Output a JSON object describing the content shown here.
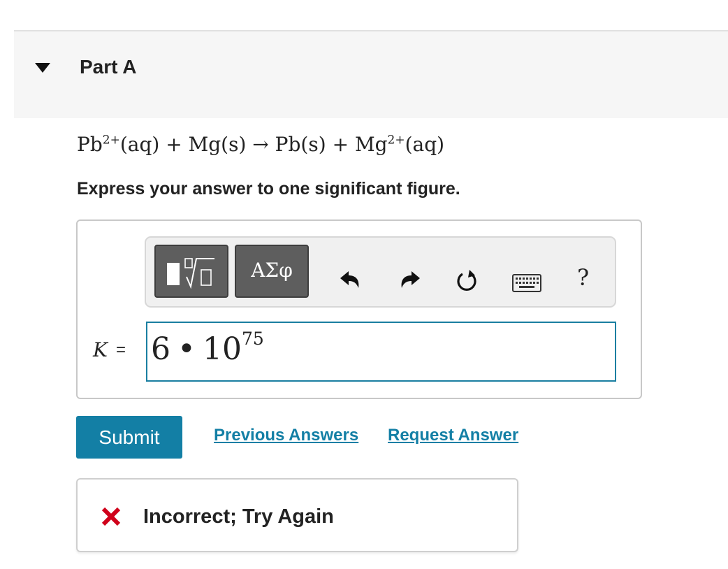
{
  "part": {
    "title": "Part A"
  },
  "equation": {
    "ion1": "Pb",
    "ion1_charge": "2+",
    "state1": "(aq)",
    "plus1": "+",
    "reactant2": "Mg(s)",
    "arrow": "→",
    "product1": "Pb(s)",
    "plus2": "+",
    "ion2": "Mg",
    "ion2_charge": "2+",
    "state2": "(aq)"
  },
  "instruction": "Express your answer to one significant figure.",
  "toolbar": {
    "templates_icon": "templates-sqrt-icon",
    "greek_label": "ΑΣφ",
    "undo_icon": "undo-icon",
    "redo_icon": "redo-icon",
    "reset_icon": "reset-icon",
    "keyboard_icon": "keyboard-icon",
    "help_label": "?"
  },
  "answer": {
    "variable": "K",
    "equals": "=",
    "coefficient": "6",
    "operator": "•",
    "base": "10",
    "exponent": "75"
  },
  "actions": {
    "submit_label": "Submit",
    "previous_answers_label": "Previous Answers",
    "request_answer_label": "Request Answer"
  },
  "feedback": {
    "icon": "incorrect-x-icon",
    "text": "Incorrect; Try Again",
    "icon_color": "#d0021b"
  },
  "colors": {
    "accent": "#137fa5",
    "error": "#d0021b",
    "header_bg": "#f6f6f6"
  }
}
